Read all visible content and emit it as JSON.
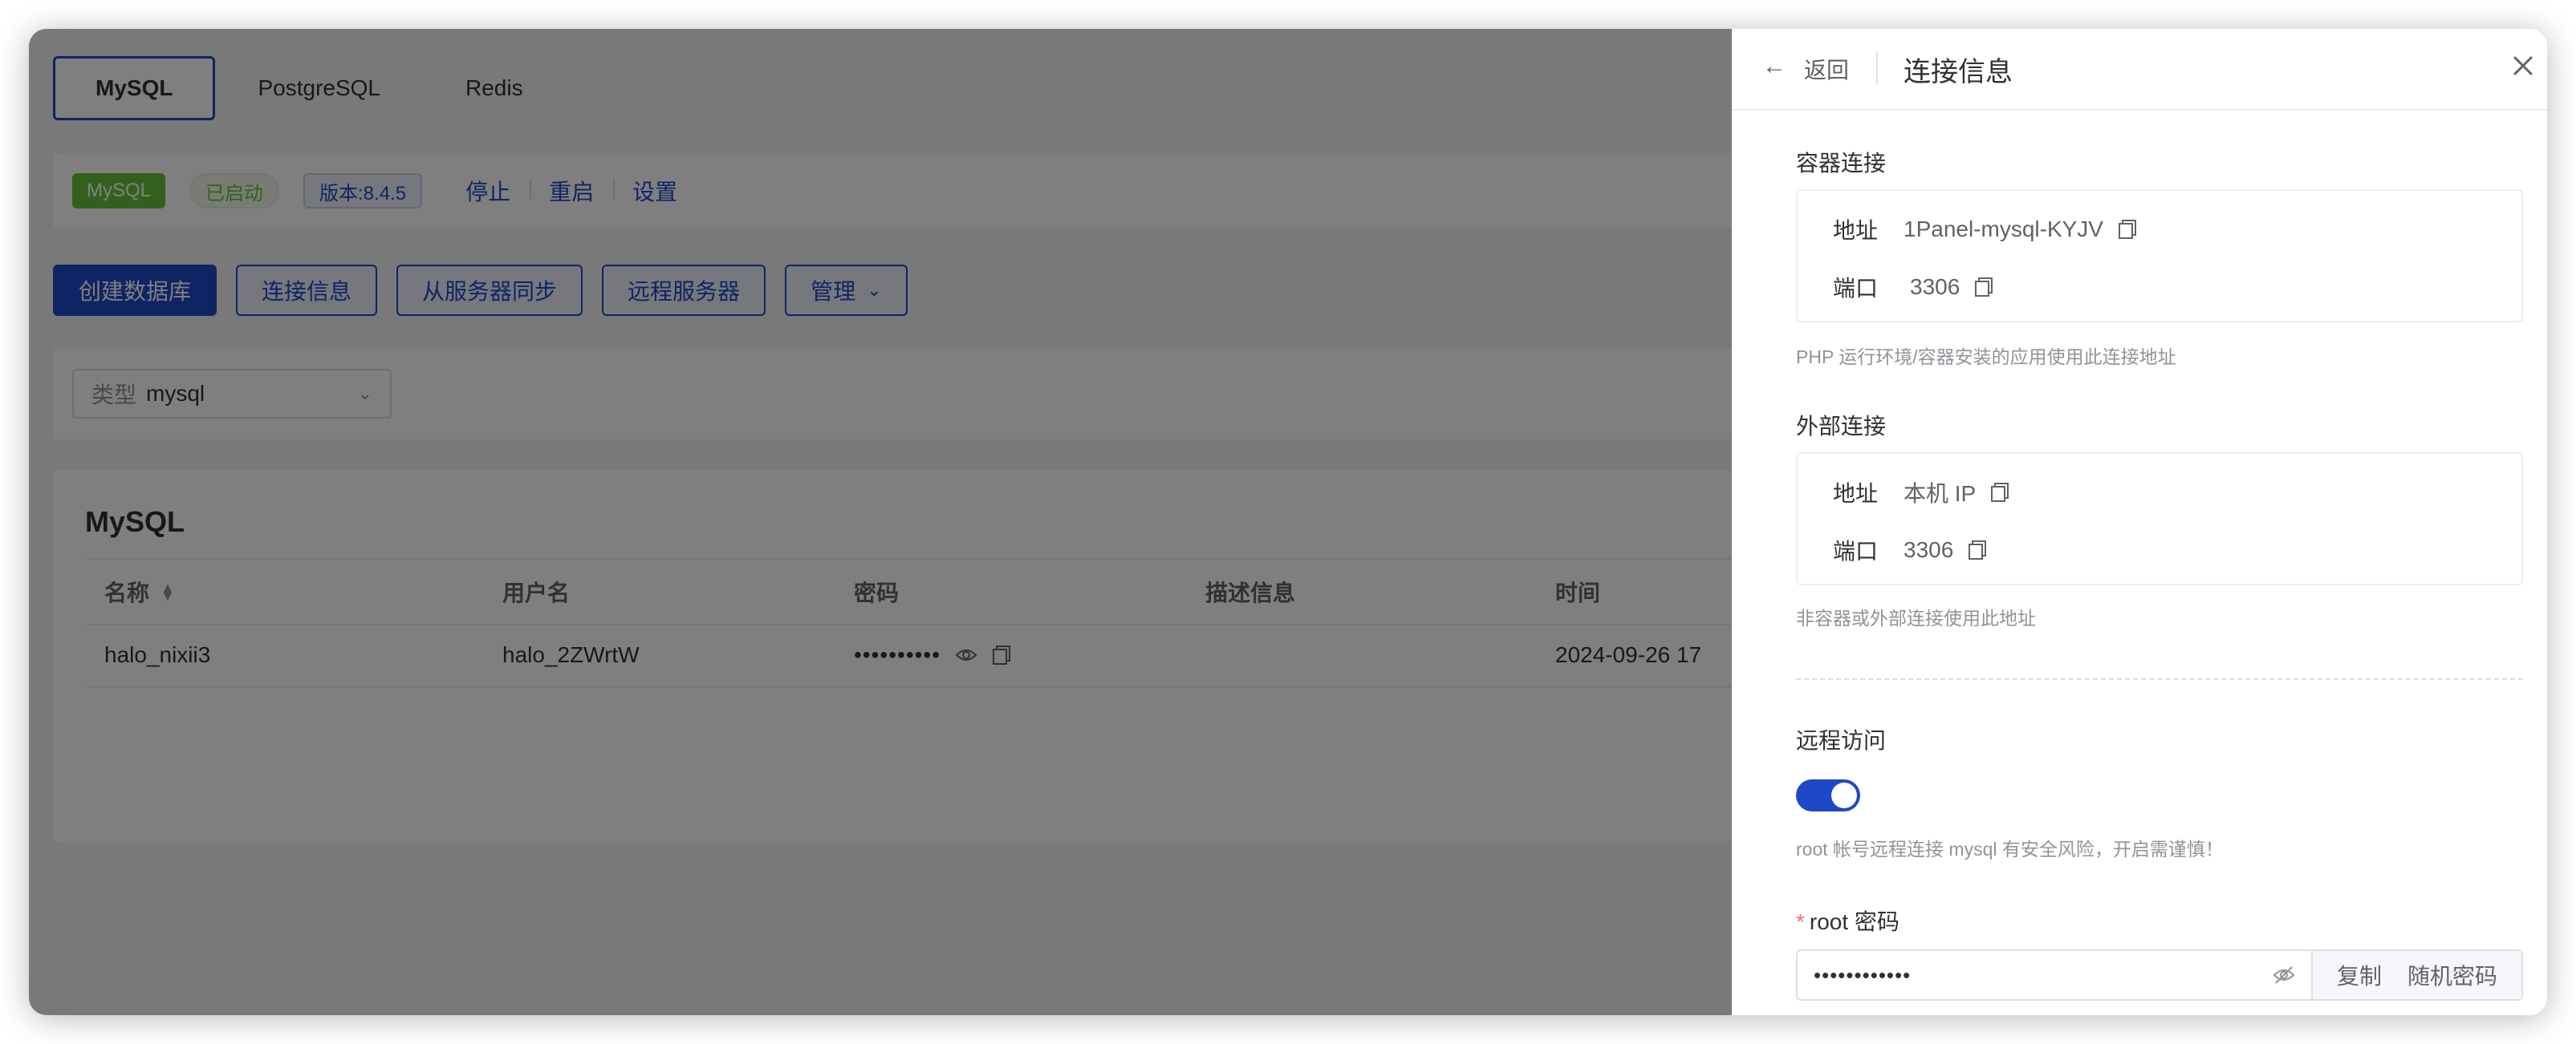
{
  "tabs": [
    {
      "label": "MySQL",
      "active": true
    },
    {
      "label": "PostgreSQL",
      "active": false
    },
    {
      "label": "Redis",
      "active": false
    }
  ],
  "status": {
    "app_tag": "MySQL",
    "state_tag": "已启动",
    "version_tag": "版本:8.4.5",
    "actions": [
      "停止",
      "重启",
      "设置"
    ]
  },
  "toolbar": {
    "create": "创建数据库",
    "conn_info": "连接信息",
    "sync": "从服务器同步",
    "remote": "远程服务器",
    "manage": "管理"
  },
  "filter": {
    "prefix": "类型",
    "value": "mysql"
  },
  "table": {
    "title": "MySQL",
    "columns": [
      "名称",
      "用户名",
      "密码",
      "描述信息",
      "时间"
    ],
    "rows": [
      {
        "name": "halo_nixii3",
        "username": "halo_2ZWrtW",
        "password_mask": "••••••••••",
        "description": "",
        "time": "2024-09-26 17"
      }
    ]
  },
  "drawer": {
    "back": "返回",
    "title": "连接信息",
    "container": {
      "label": "容器连接",
      "addr_key": "地址",
      "addr_val": "1Panel-mysql-KYJV",
      "port_key": "端口",
      "port_val": "3306",
      "hint": "PHP 运行环境/容器安装的应用使用此连接地址"
    },
    "external": {
      "label": "外部连接",
      "addr_key": "地址",
      "addr_val": "本机 IP",
      "port_key": "端口",
      "port_val": "3306",
      "hint": "非容器或外部连接使用此地址"
    },
    "remote": {
      "label": "远程访问",
      "enabled": true,
      "hint": "root 帐号远程连接 mysql 有安全风险，开启需谨慎！"
    },
    "root_password": {
      "required_mark": "*",
      "label": "root 密码",
      "value_mask": "••••••••••••",
      "copy": "复制",
      "random": "随机密码"
    }
  },
  "colors": {
    "accent": "#1e48c8",
    "success": "#67c23a",
    "danger": "#f56c6c"
  }
}
